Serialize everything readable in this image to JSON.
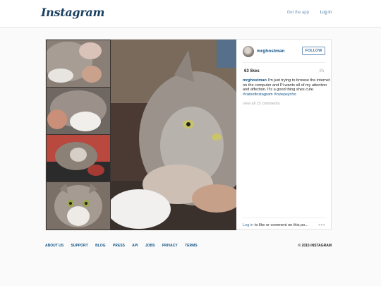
{
  "header": {
    "logo": "Instagram",
    "get_app": "Get the app",
    "login": "Log in"
  },
  "post": {
    "username": "mrghostman",
    "follow_label": "FOLLOW",
    "likes": "63 likes",
    "age": "2h",
    "caption_user": "mrghostman",
    "caption_text": " I'm just trying to browse the internet on the computer and Pi wants all of my attention and affection. It's a good thing shes cute. ",
    "tags": [
      "#catsofinstagram",
      "#cutepsycho"
    ],
    "view_all": "view all 15 comments",
    "login_link": "Log in",
    "login_rest": " to like or comment on this po...",
    "more": "•••"
  },
  "footer": {
    "links": [
      "ABOUT US",
      "SUPPORT",
      "BLOG",
      "PRESS",
      "API",
      "JOBS",
      "PRIVACY",
      "TERMS"
    ],
    "copyright": "© 2015 INSTAGRAM"
  },
  "colors": {
    "link_blue": "#125688",
    "secondary_blue": "#3f729b",
    "logo_navy": "#1b3f61",
    "background": "#fafafa"
  }
}
